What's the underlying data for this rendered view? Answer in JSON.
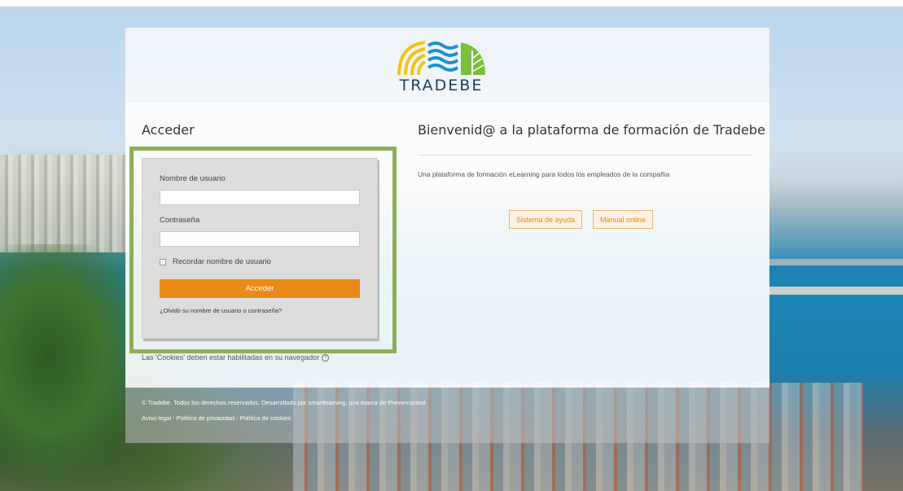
{
  "logo": {
    "text": "TRADEBE"
  },
  "login": {
    "title": "Acceder",
    "username_label": "Nombre de usuario",
    "username_value": "",
    "password_label": "Contraseña",
    "password_value": "",
    "remember_label": "Recordar nombre de usuario",
    "submit_label": "Acceder",
    "forgot_link": "¿Olvidó su nombre de usuario o contraseña?",
    "cookies_notice": "Las 'Cookies' deben estar habilitadas en su navegador"
  },
  "welcome": {
    "title": "Bienvenid@ a la plataforma de formación de Tradebe",
    "description": "Una plataforma de formación eLearning para todos los empleados de la compañia",
    "buttons": [
      "Sistema de ayuda",
      "Manual online"
    ]
  },
  "footer": {
    "line1": "© Tradebe. Todos los derechos reservados. Desarrollado por smartlearning, una marca de Prevencontrol",
    "line2": "Aviso legal - Política de privacidad - Política de cookies"
  },
  "colors": {
    "accent": "#ea8a18",
    "highlight": "#8db055",
    "logo_text": "#1f3d57"
  }
}
